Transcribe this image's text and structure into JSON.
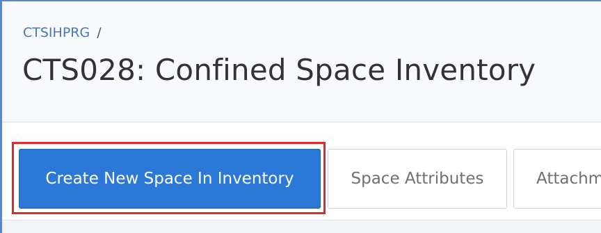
{
  "breadcrumb": {
    "parent": "CTSIHPRG",
    "separator": "/"
  },
  "header": {
    "title": "CTS028: Confined Space Inventory"
  },
  "toolbar": {
    "buttons": [
      {
        "label": "Create New Space In Inventory",
        "state": "highlighted"
      },
      {
        "label": "Space Attributes"
      },
      {
        "label": "Attachm"
      }
    ]
  },
  "colors": {
    "primary_button": "#2b78d6",
    "highlight_border": "#e02a2a",
    "breadcrumb_link": "#4a77b8",
    "frame_border": "#5b86c9"
  }
}
